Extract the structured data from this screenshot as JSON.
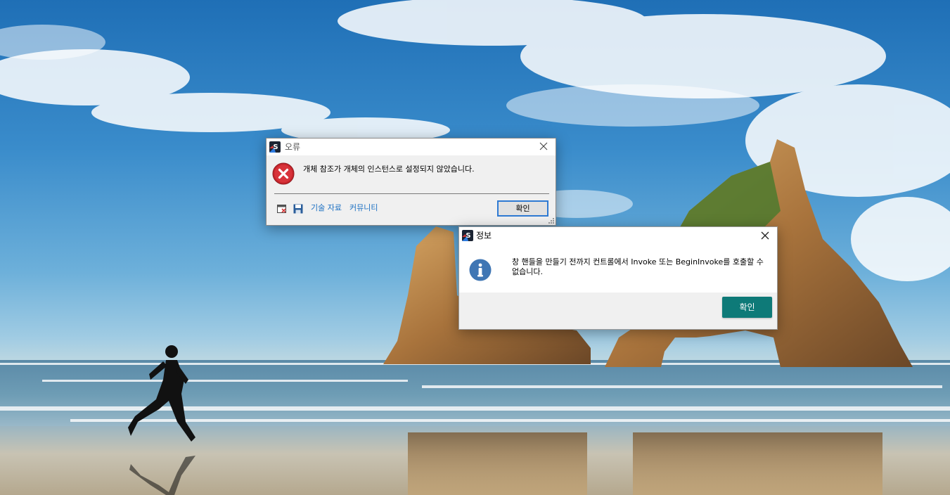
{
  "desktop": {
    "wallpaper": "beach-with-rock-arches-and-runner"
  },
  "error_dialog": {
    "title": "오류",
    "icon": "error-x-icon",
    "message": "개체 참조가 개체의 인스턴스로 설정되지 않았습니다.",
    "links": {
      "technical_docs": "기술 자료",
      "community": "커뮤니티"
    },
    "ok_label": "확인",
    "accent": "#2f7ad3"
  },
  "info_dialog": {
    "title": "정보",
    "icon": "information-icon",
    "message": "창 핸들을 만들기 전까지 컨트롤에서 Invoke 또는 BeginInvoke를 호출할 수 없습니다.",
    "ok_label": "확인",
    "accent": "#0e7a78"
  },
  "colors": {
    "error_red": "#c8262d",
    "info_blue": "#3f76b4",
    "link_blue": "#1a6fc2"
  }
}
